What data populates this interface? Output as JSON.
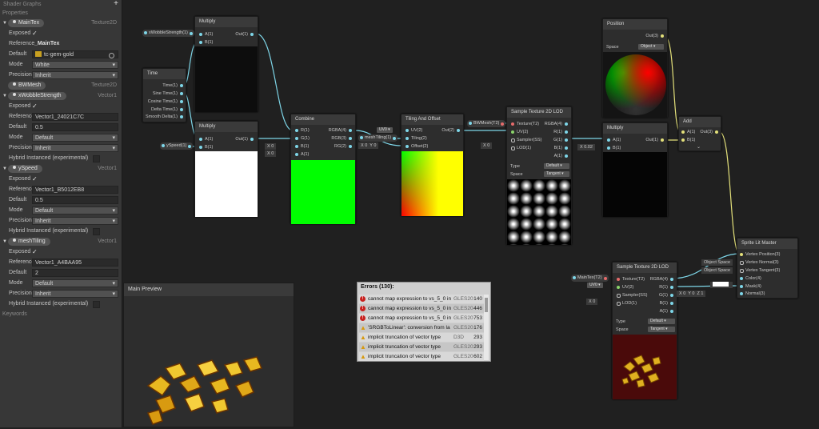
{
  "sidebar": {
    "title": "Shader Graphs",
    "add_label": "+",
    "section": "Properties",
    "footer": "Keywords",
    "colors": {
      "panel": "#373737",
      "field": "#2a2a2a"
    }
  },
  "props": {
    "maintex": {
      "name": "MainTex",
      "type": "Texture2D",
      "exposed_label": "Exposed",
      "ref_label": "Reference",
      "ref": "_MainTex",
      "default_label": "Default",
      "default": "tc-gem-gold",
      "mode_label": "Mode",
      "mode": "White",
      "precision_label": "Precision",
      "precision": "Inherit"
    },
    "bwmesh": {
      "name": "BWMesh",
      "type": "Texture2D"
    },
    "wobble": {
      "name": "xWobbleStrength",
      "type": "Vector1",
      "exposed_label": "Exposed",
      "ref_label": "Reference",
      "ref": "Vector1_24021C7C",
      "default_label": "Default",
      "default": "0.5",
      "mode_label": "Mode",
      "mode": "Default",
      "precision_label": "Precision",
      "precision": "Inherit",
      "hybrid_label": "Hybrid Instanced (experimental)"
    },
    "yspeed": {
      "name": "ySpeed",
      "type": "Vector1",
      "exposed_label": "Exposed",
      "ref_label": "Reference",
      "ref": "Vector1_B5012EB8",
      "default_label": "Default",
      "default": "0.5",
      "mode_label": "Mode",
      "mode": "Default",
      "precision_label": "Precision",
      "precision": "Inherit",
      "hybrid_label": "Hybrid Instanced (experimental)"
    },
    "meshtiling": {
      "name": "meshTiling",
      "type": "Vector1",
      "exposed_label": "Exposed",
      "ref_label": "Reference",
      "ref": "Vector1_A4BAA95",
      "default_label": "Default",
      "default": "2",
      "mode_label": "Mode",
      "mode": "Default",
      "precision_label": "Precision",
      "precision": "Inherit",
      "hybrid_label": "Hybrid Instanced (experimental)"
    }
  },
  "nodes": {
    "multiply1": {
      "title": "Multiply",
      "a": "A(1)",
      "b": "B(1)",
      "out": "Out(1)"
    },
    "time": {
      "title": "Time",
      "outs": [
        "Time(1)",
        "Sine Time(1)",
        "Cosine Time(1)",
        "Delta Time(1)",
        "Smooth Delta(1)"
      ]
    },
    "multiply2": {
      "title": "Multiply",
      "a": "A(1)",
      "b": "B(1)",
      "out": "Out(1)"
    },
    "combine": {
      "title": "Combine",
      "ins": [
        "R(1)",
        "G(1)",
        "B(1)",
        "A(1)"
      ],
      "outs": [
        "RGBA(4)",
        "RGB(3)",
        "RG(2)"
      ]
    },
    "tiling": {
      "title": "Tiling And Offset",
      "ins": [
        "UV(2)",
        "Tiling(2)",
        "Offset(2)"
      ],
      "out": "Out(2)"
    },
    "sample1": {
      "title": "Sample Texture 2D LOD",
      "ins": [
        "Texture(T2)",
        "UV(2)",
        "Sampler(SS)",
        "LOD(1)"
      ],
      "outs": [
        "RGBA(4)",
        "R(1)",
        "G(1)",
        "B(1)",
        "A(1)"
      ],
      "type_label": "Type",
      "type": "Default",
      "space_label": "Space",
      "space": "Tangent"
    },
    "position": {
      "title": "Position",
      "out": "Out(3)",
      "space_label": "Space",
      "space": "Object"
    },
    "multiply3": {
      "title": "Multiply",
      "a": "A(1)",
      "b": "B(1)",
      "out": "Out(1)"
    },
    "add": {
      "title": "Add",
      "a": "A(1)",
      "b": "B(1)",
      "out": "Out(3)"
    },
    "master": {
      "title": "Sprite Lit Master",
      "ins": [
        "Vertex Position(3)",
        "Vertex Normal(3)",
        "Vertex Tangent(3)",
        "Color(4)",
        "Mask(4)",
        "Normal(3)"
      ]
    },
    "sample2": {
      "title": "Sample Texture 2D LOD",
      "ins": [
        "Texture(T2)",
        "UV(2)",
        "Sampler(SS)",
        "LOD(1)"
      ],
      "outs": [
        "RGBA(4)",
        "R(1)",
        "G(1)",
        "B(1)",
        "A(1)"
      ],
      "type_label": "Type",
      "type": "Default",
      "space_label": "Space",
      "space": "Tangent"
    }
  },
  "pins": {
    "wobble": "xWobbleStrength(1)",
    "yspeed": "ySpeed(1)",
    "meshtiling": "meshTiling(1)",
    "bwmesh": "BWMesh(T2)",
    "maintex": "MainTex(T2)",
    "uv0": "UV0",
    "uv0b": "UV0",
    "zero": "0",
    "x": "X",
    "y": "Y",
    "z": "Z",
    "mul_b": "0.02",
    "master_tint": "1",
    "obj_space1": "Object Space",
    "obj_space2": "Object Space"
  },
  "main_preview": {
    "title": "Main Preview"
  },
  "errors": {
    "title": "Errors (130):",
    "rows": [
      {
        "kind": "error",
        "text": "cannot map expression to vs_5_0 in",
        "platform": "GLES20",
        "line": "140"
      },
      {
        "kind": "error",
        "text": "cannot map expression to vs_5_0 in",
        "platform": "GLES20",
        "line": "446"
      },
      {
        "kind": "error",
        "text": "cannot map expression to vs_5_0 in",
        "platform": "GLES20",
        "line": "753"
      },
      {
        "kind": "warning",
        "text": "'SRGBToLinear': conversion from la",
        "platform": "GLES20",
        "line": "176"
      },
      {
        "kind": "warning",
        "text": "implicit truncation of vector type",
        "platform": "D3D",
        "line": "293"
      },
      {
        "kind": "warning",
        "text": "implicit truncation of vector type",
        "platform": "GLES20",
        "line": "293"
      },
      {
        "kind": "warning",
        "text": "implicit truncation of vector type",
        "platform": "GLES20",
        "line": "602"
      }
    ]
  },
  "colors": {
    "wire": "#7ed6e8",
    "wire_yellow": "#e3e07a",
    "canvas": "#202020",
    "node": "#2d2d2d",
    "error": "#c8201e",
    "warning": "#d79a10"
  }
}
